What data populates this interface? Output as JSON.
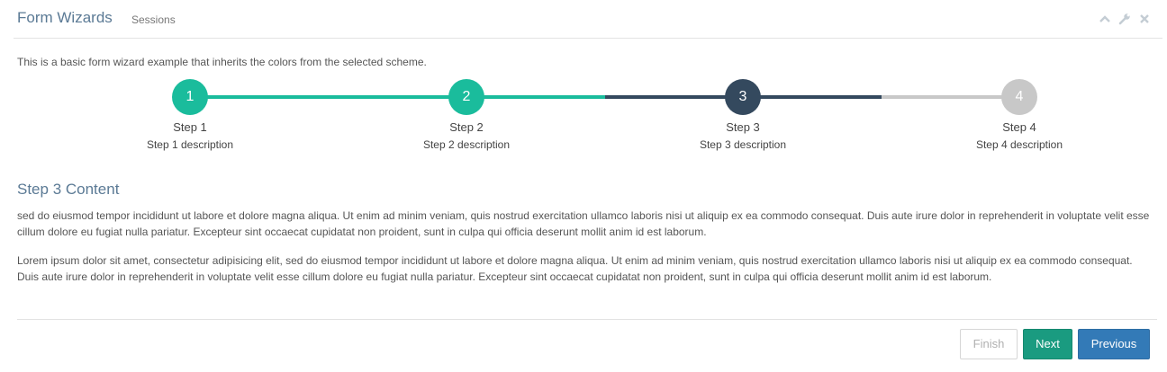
{
  "header": {
    "title": "Form Wizards",
    "subtitle": "Sessions",
    "tools": [
      "chevron-up-icon",
      "wrench-icon",
      "close-icon"
    ]
  },
  "intro": "This is a basic form wizard example that inherits the colors from the selected scheme.",
  "colors": {
    "completed": "#1abc9c",
    "active": "#34495e",
    "pending": "#c8c8c8"
  },
  "wizard": {
    "current_step": 3,
    "steps": [
      {
        "number": "1",
        "label": "Step 1",
        "description": "Step 1 description",
        "state": "completed"
      },
      {
        "number": "2",
        "label": "Step 2",
        "description": "Step 2 description",
        "state": "completed"
      },
      {
        "number": "3",
        "label": "Step 3",
        "description": "Step 3 description",
        "state": "active"
      },
      {
        "number": "4",
        "label": "Step 4",
        "description": "Step 4 description",
        "state": "pending"
      }
    ]
  },
  "content": {
    "title": "Step 3 Content",
    "paragraphs": [
      "sed do eiusmod tempor incididunt ut labore et dolore magna aliqua. Ut enim ad minim veniam, quis nostrud exercitation ullamco laboris nisi ut aliquip ex ea commodo consequat. Duis aute irure dolor in reprehenderit in voluptate velit esse cillum dolore eu fugiat nulla pariatur. Excepteur sint occaecat cupidatat non proident, sunt in culpa qui officia deserunt mollit anim id est laborum.",
      "Lorem ipsum dolor sit amet, consectetur adipisicing elit, sed do eiusmod tempor incididunt ut labore et dolore magna aliqua. Ut enim ad minim veniam, quis nostrud exercitation ullamco laboris nisi ut aliquip ex ea commodo consequat. Duis aute irure dolor in reprehenderit in voluptate velit esse cillum dolore eu fugiat nulla pariatur. Excepteur sint occaecat cupidatat non proident, sunt in culpa qui officia deserunt mollit anim id est laborum."
    ]
  },
  "buttons": {
    "finish": "Finish",
    "next": "Next",
    "previous": "Previous"
  }
}
